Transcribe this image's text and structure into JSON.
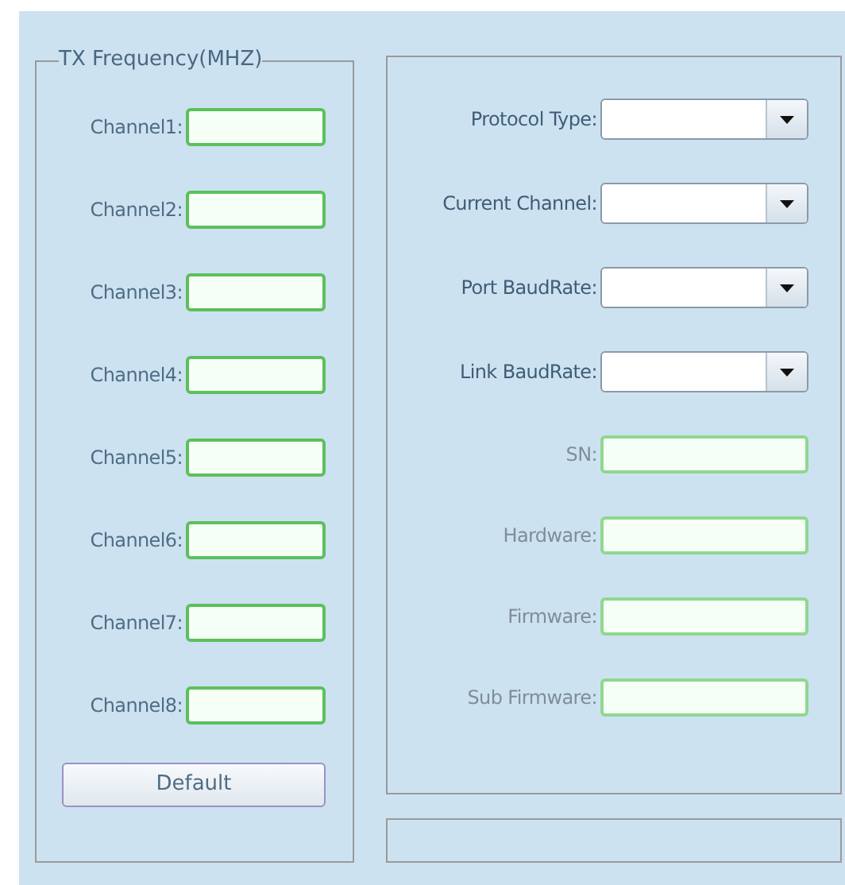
{
  "tx_frequency": {
    "title": "TX Frequency(MHZ)",
    "channels": [
      {
        "label": "Channel1:"
      },
      {
        "label": "Channel2:"
      },
      {
        "label": "Channel3:"
      },
      {
        "label": "Channel4:"
      },
      {
        "label": "Channel5:"
      },
      {
        "label": "Channel6:"
      },
      {
        "label": "Channel7:"
      },
      {
        "label": "Channel8:"
      }
    ],
    "default_button": "Default"
  },
  "device": {
    "fields": [
      {
        "label": "Protocol Type:",
        "kind": "dropdown",
        "disabled": false
      },
      {
        "label": "Current Channel:",
        "kind": "dropdown",
        "disabled": false
      },
      {
        "label": "Port BaudRate:",
        "kind": "dropdown",
        "disabled": false
      },
      {
        "label": "Link BaudRate:",
        "kind": "dropdown",
        "disabled": false
      },
      {
        "label": "SN:",
        "kind": "text",
        "disabled": true
      },
      {
        "label": "Hardware:",
        "kind": "text",
        "disabled": true
      },
      {
        "label": "Firmware:",
        "kind": "text",
        "disabled": true
      },
      {
        "label": "Sub Firmware:",
        "kind": "text",
        "disabled": true
      }
    ]
  }
}
